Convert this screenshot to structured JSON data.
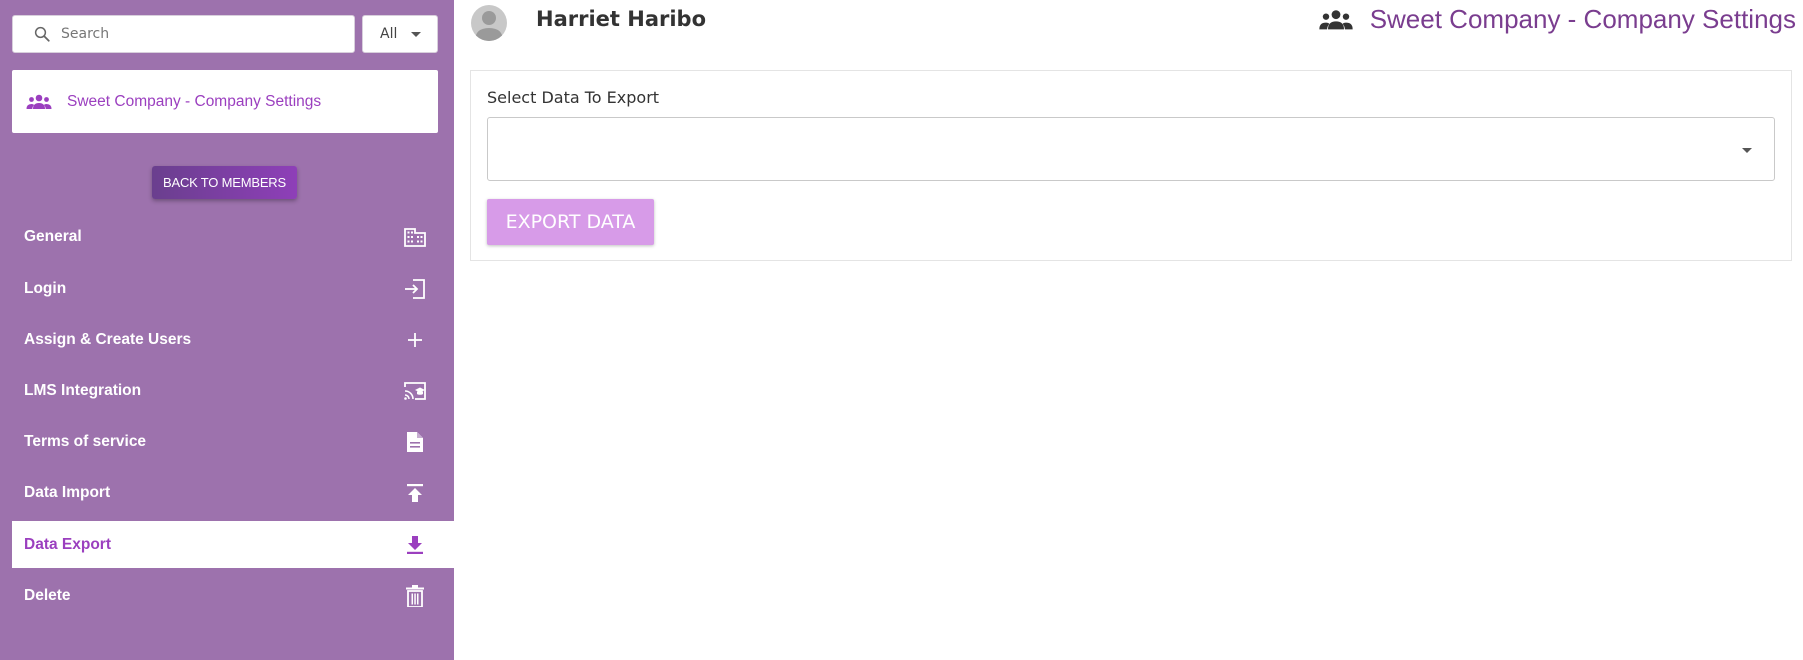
{
  "sidebar": {
    "search": {
      "placeholder": "Search",
      "value": ""
    },
    "filter": {
      "selected": "All"
    },
    "company_card": {
      "label": "Sweet Company - Company Settings"
    },
    "back_button": {
      "label": "BACK TO MEMBERS"
    },
    "nav": [
      {
        "label": "General",
        "icon": "building-icon",
        "active": false
      },
      {
        "label": "Login",
        "icon": "login-icon",
        "active": false
      },
      {
        "label": "Assign & Create Users",
        "icon": "plus-icon",
        "active": false
      },
      {
        "label": "LMS Integration",
        "icon": "cast-education-icon",
        "active": false
      },
      {
        "label": "Terms of service",
        "icon": "document-icon",
        "active": false
      },
      {
        "label": "Data Import",
        "icon": "upload-icon",
        "active": false
      },
      {
        "label": "Data Export",
        "icon": "download-icon",
        "active": true
      },
      {
        "label": "Delete",
        "icon": "trash-icon",
        "active": false
      }
    ]
  },
  "header": {
    "user_name": "Harriet Haribo",
    "title": "Sweet Company - Company Settings"
  },
  "main": {
    "select_label": "Select Data To Export",
    "select_value": "",
    "export_button": "EXPORT DATA"
  },
  "colors": {
    "sidebar_bg": "#9d72ad",
    "accent": "#9b3fbf",
    "title": "#7a3d8f",
    "export_button": "#d79be8"
  }
}
